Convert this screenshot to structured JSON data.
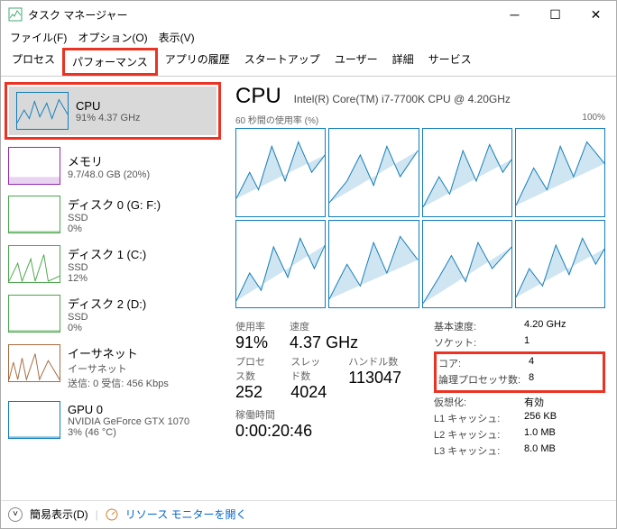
{
  "window": {
    "title": "タスク マネージャー"
  },
  "menu": {
    "file": "ファイル(F)",
    "options": "オプション(O)",
    "view": "表示(V)"
  },
  "tabs": {
    "processes": "プロセス",
    "performance": "パフォーマンス",
    "app_history": "アプリの履歴",
    "startup": "スタートアップ",
    "users": "ユーザー",
    "details": "詳細",
    "services": "サービス"
  },
  "sidebar": {
    "cpu": {
      "title": "CPU",
      "sub": "91%  4.37 GHz"
    },
    "memory": {
      "title": "メモリ",
      "sub": "9.7/48.0 GB (20%)"
    },
    "disk0": {
      "title": "ディスク 0 (G: F:)",
      "sub": "SSD",
      "sub2": "0%"
    },
    "disk1": {
      "title": "ディスク 1 (C:)",
      "sub": "SSD",
      "sub2": "12%"
    },
    "disk2": {
      "title": "ディスク 2 (D:)",
      "sub": "SSD",
      "sub2": "0%"
    },
    "ethernet": {
      "title": "イーサネット",
      "sub": "イーサネット",
      "sub2": "送信: 0 受信: 456 Kbps"
    },
    "gpu": {
      "title": "GPU 0",
      "sub": "NVIDIA GeForce GTX 1070",
      "sub2": "3% (46 °C)"
    }
  },
  "detail": {
    "title": "CPU",
    "subtitle": "Intel(R) Core(TM) i7-7700K CPU @ 4.20GHz",
    "chart_label_left": "60 秒間の使用率 (%)",
    "chart_label_right": "100%",
    "stats": {
      "usage_label": "使用率",
      "usage_val": "91%",
      "speed_label": "速度",
      "speed_val": "4.37 GHz",
      "processes_label": "プロセス数",
      "processes_val": "252",
      "threads_label": "スレッド数",
      "threads_val": "4024",
      "handles_label": "ハンドル数",
      "handles_val": "113047",
      "uptime_label": "稼働時間",
      "uptime_val": "0:00:20:46"
    },
    "kv": {
      "base_speed_k": "基本速度:",
      "base_speed_v": "4.20 GHz",
      "sockets_k": "ソケット:",
      "sockets_v": "1",
      "cores_k": "コア:",
      "cores_v": "4",
      "logical_k": "論理プロセッサ数:",
      "logical_v": "8",
      "virt_k": "仮想化:",
      "virt_v": "有効",
      "l1_k": "L1 キャッシュ:",
      "l1_v": "256 KB",
      "l2_k": "L2 キャッシュ:",
      "l2_v": "1.0 MB",
      "l3_k": "L3 キャッシュ:",
      "l3_v": "8.0 MB"
    }
  },
  "footer": {
    "brief": "簡易表示(D)",
    "resmon": "リソース モニターを開く"
  }
}
